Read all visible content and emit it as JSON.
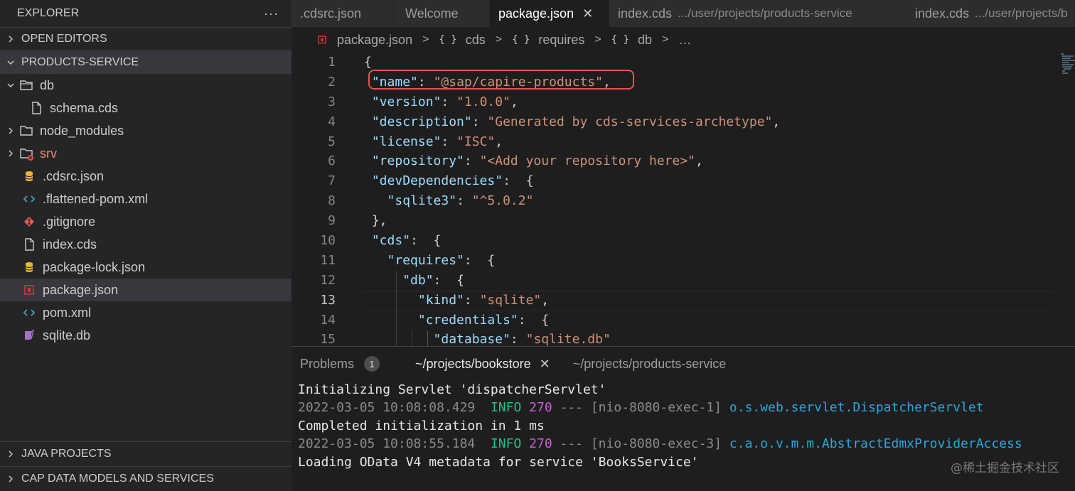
{
  "explorer": {
    "title": "EXPLORER",
    "more": "···",
    "sections": {
      "open_editors": "OPEN EDITORS",
      "products_service": "PRODUCTS-SERVICE",
      "java_projects": "JAVA PROJECTS",
      "cap_data_models": "CAP DATA MODELS AND SERVICES"
    },
    "tree": [
      {
        "label": "db",
        "icon": "folder-open-icon"
      },
      {
        "label": "schema.cds",
        "icon": "file-icon"
      },
      {
        "label": "node_modules",
        "icon": "folder-icon"
      },
      {
        "label": "srv",
        "icon": "folder-error-icon"
      },
      {
        "label": ".cdsrc.json",
        "icon": "database-icon"
      },
      {
        "label": ".flattened-pom.xml",
        "icon": "code-icon"
      },
      {
        "label": ".gitignore",
        "icon": "git-icon"
      },
      {
        "label": "index.cds",
        "icon": "file-icon"
      },
      {
        "label": "package-lock.json",
        "icon": "database-icon"
      },
      {
        "label": "package.json",
        "icon": "package-icon"
      },
      {
        "label": "pom.xml",
        "icon": "code-icon"
      },
      {
        "label": "sqlite.db",
        "icon": "sqlite-icon"
      }
    ]
  },
  "tabs": [
    {
      "label": ".cdsrc.json",
      "desc": ""
    },
    {
      "label": "Welcome",
      "desc": ""
    },
    {
      "label": "package.json",
      "desc": "",
      "close": "✕"
    },
    {
      "label": "index.cds",
      "desc": ".../user/projects/products-service"
    },
    {
      "label": "index.cds",
      "desc": ".../user/projects/b"
    }
  ],
  "breadcrumb": {
    "file": "package.json",
    "items": [
      "cds",
      "requires",
      "db"
    ],
    "braces": "{ }",
    "ellipsis": "…"
  },
  "editor": {
    "line_numbers": [
      "1",
      "2",
      "3",
      "4",
      "5",
      "6",
      "7",
      "8",
      "9",
      "10",
      "11",
      "12",
      "13",
      "14",
      "15"
    ],
    "current_line": "13",
    "lines": [
      {
        "indent": "",
        "key": "",
        "val": "",
        "text": "{"
      },
      {
        "indent": " ",
        "key": "\"name\"",
        "val": "\"@sap/capire-products\"",
        "end": ","
      },
      {
        "indent": " ",
        "key": "\"version\"",
        "val": "\"1.0.0\"",
        "end": ","
      },
      {
        "indent": " ",
        "key": "\"description\"",
        "val": "\"Generated by cds-services-archetype\"",
        "end": ","
      },
      {
        "indent": " ",
        "key": "\"license\"",
        "val": "\"ISC\"",
        "end": ","
      },
      {
        "indent": " ",
        "key": "\"repository\"",
        "val": "\"<Add your repository here>\"",
        "end": ","
      },
      {
        "indent": " ",
        "key": "\"devDependencies\"",
        "val": "",
        "end": " {"
      },
      {
        "indent": "   ",
        "key": "\"sqlite3\"",
        "val": "\"^5.0.2\"",
        "end": ""
      },
      {
        "indent": " ",
        "key": "",
        "val": "",
        "text": "},"
      },
      {
        "indent": " ",
        "key": "\"cds\"",
        "val": "",
        "end": " {"
      },
      {
        "indent": "   ",
        "key": "\"requires\"",
        "val": "",
        "end": " {"
      },
      {
        "indent": "     ",
        "key": "\"db\"",
        "val": "",
        "end": " {"
      },
      {
        "indent": "       ",
        "key": "\"kind\"",
        "val": "\"sqlite\"",
        "end": ","
      },
      {
        "indent": "       ",
        "key": "\"credentials\"",
        "val": "",
        "end": " {"
      },
      {
        "indent": "         ",
        "key": "\"database\"",
        "val": "\"sqlite.db\"",
        "end": ""
      }
    ]
  },
  "panel": {
    "tabs": [
      {
        "label": "Problems",
        "badge": "1"
      },
      {
        "label": "~/projects/bookstore",
        "close": "✕"
      },
      {
        "label": "~/projects/products-service"
      }
    ],
    "terminal": {
      "line1": "Initializing Servlet 'dispatcherServlet'",
      "log1": {
        "date": "2022-03-05 10:08:08.429",
        "level": "INFO",
        "pid": "270",
        "thread": "--- [nio-8080-exec-1]",
        "cls": "o.s.web.servlet.DispatcherServlet"
      },
      "line2": "Completed initialization in 1 ms",
      "log2": {
        "date": "2022-03-05 10:08:55.184",
        "level": "INFO",
        "pid": "270",
        "thread": "--- [nio-8080-exec-3]",
        "cls": "c.a.o.v.m.m.AbstractEdmxProviderAccess"
      },
      "line3": "Loading OData V4 metadata for service 'BooksService'"
    },
    "watermark": "@稀土掘金技术社区"
  },
  "colors": {
    "highlight_box": "#e8524f",
    "json_key": "#9cdcfe",
    "json_string": "#ce9178",
    "info": "#1fc08a",
    "class": "#2aa6dc"
  }
}
